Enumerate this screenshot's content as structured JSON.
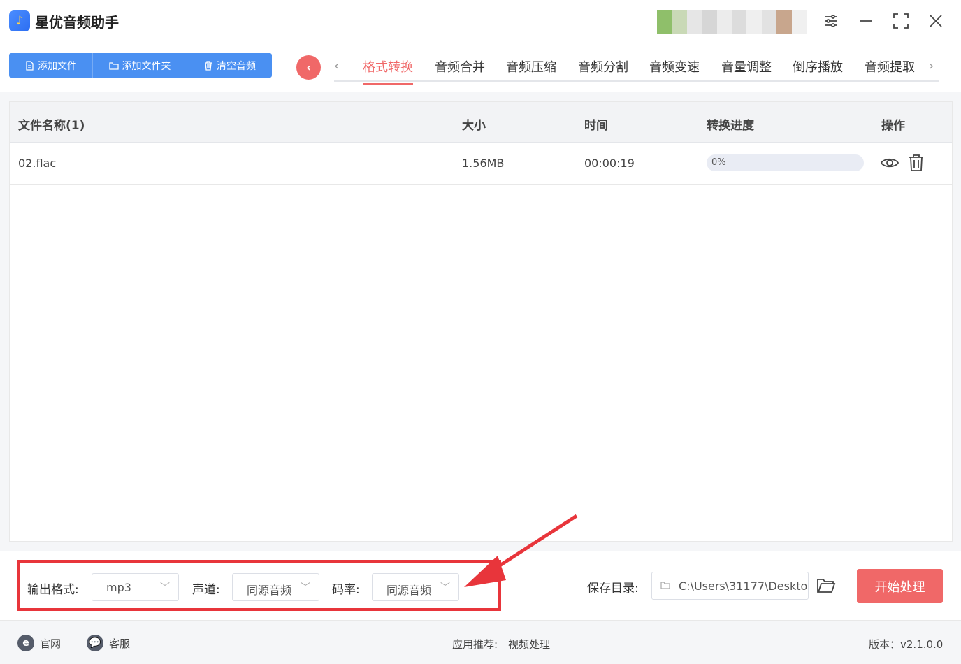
{
  "app": {
    "title": "星优音频助手",
    "icon": "music-note-icon"
  },
  "toolbar": {
    "add_file": "添加文件",
    "add_folder": "添加文件夹",
    "clear": "清空音频"
  },
  "tabs": [
    "格式转换",
    "音频合并",
    "音频压缩",
    "音频分割",
    "音频变速",
    "音量调整",
    "倒序播放",
    "音频提取"
  ],
  "active_tab": "格式转换",
  "table": {
    "headers": {
      "name": "文件名称(1)",
      "size": "大小",
      "time": "时间",
      "progress": "转换进度",
      "ops": "操作"
    },
    "rows": [
      {
        "name": "02.flac",
        "size": "1.56MB",
        "time": "00:00:19",
        "progress": "0%",
        "progress_value": 0
      }
    ]
  },
  "settings": {
    "format_label": "输出格式:",
    "format_value": "mp3",
    "channel_label": "声道:",
    "channel_value": "同源音频",
    "bitrate_label": "码率:",
    "bitrate_value": "同源音频",
    "save_label": "保存目录:",
    "save_path": "C:\\Users\\31177\\Deskto",
    "start": "开始处理"
  },
  "footer": {
    "website": "官网",
    "service": "客服",
    "recommend_label": "应用推荐:",
    "recommend_value": "视频处理",
    "version": "版本：v2.1.0.0"
  },
  "colors": {
    "accent": "#f06868",
    "primary": "#4a90f2",
    "annotation": "#e8353b"
  }
}
